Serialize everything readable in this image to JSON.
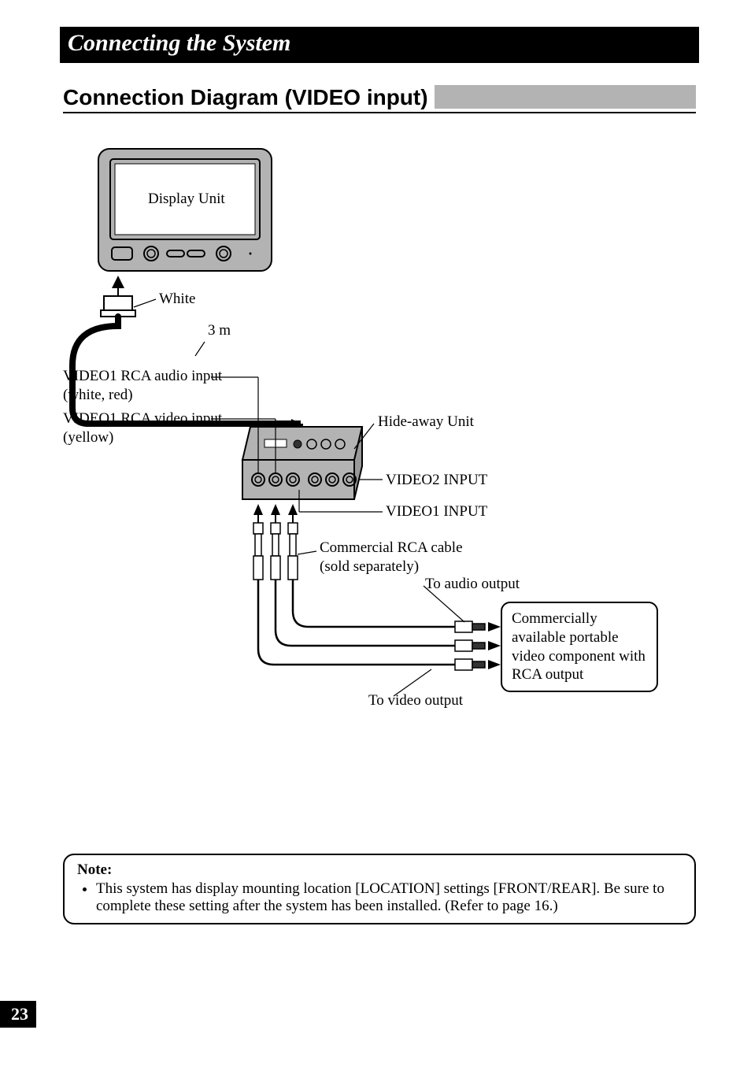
{
  "chapter": "Connecting the System",
  "section": "Connection Diagram (VIDEO input)",
  "labels": {
    "display_unit": "Display Unit",
    "white": "White",
    "cable_length": "3 m",
    "video1_rca_audio": "VIDEO1 RCA audio input\n(white, red)",
    "video1_rca_video": "VIDEO1 RCA video input\n(yellow)",
    "hide_away": "Hide-away Unit",
    "video2_input": "VIDEO2 INPUT",
    "video1_input": "VIDEO1 INPUT",
    "commercial_rca": "Commercial RCA cable\n(sold separately)",
    "to_audio": "To audio output",
    "to_video": "To video output",
    "portable_component": "Commercially available portable video component with RCA output"
  },
  "note": {
    "heading": "Note:",
    "body": "This system has display mounting location [LOCATION] settings [FRONT/REAR]. Be sure to complete these setting after the system has been installed. (Refer to page 16.)"
  },
  "page_number": "23"
}
